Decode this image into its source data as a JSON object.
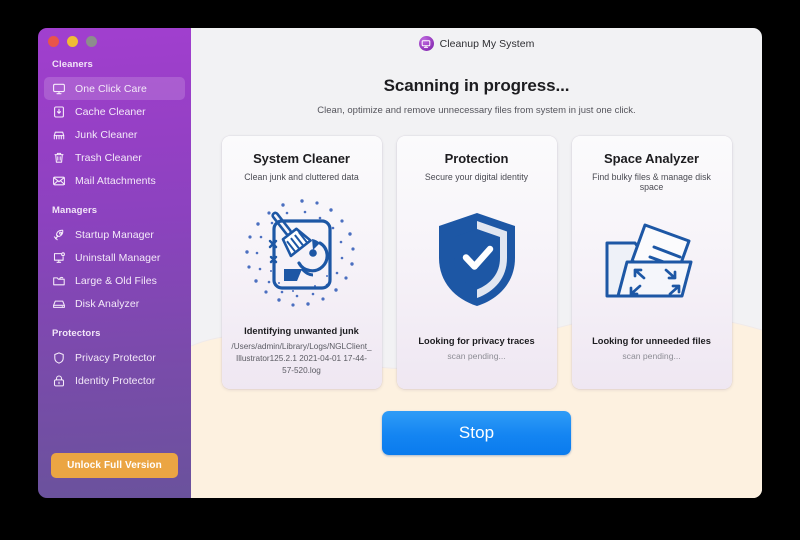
{
  "window": {
    "traffic_lights": [
      {
        "name": "close",
        "color": "#e8554a"
      },
      {
        "name": "minimize",
        "color": "#f0bb35"
      },
      {
        "name": "zoom",
        "color": "#8d8d8d"
      }
    ]
  },
  "header": {
    "app_title": "Cleanup My System",
    "app_icon": "monitor-icon",
    "headline": "Scanning in progress...",
    "subhead": "Clean, optimize and remove unnecessary files from system in just one click."
  },
  "sidebar": {
    "accent_button_color": "#eba543",
    "groups": [
      {
        "label": "Cleaners",
        "items": [
          {
            "label": "One Click Care",
            "icon": "monitor-icon",
            "active": true
          },
          {
            "label": "Cache Cleaner",
            "icon": "cache-box-icon",
            "active": false
          },
          {
            "label": "Junk Cleaner",
            "icon": "broom-icon",
            "active": false
          },
          {
            "label": "Trash Cleaner",
            "icon": "trash-icon",
            "active": false
          },
          {
            "label": "Mail Attachments",
            "icon": "envelope-icon",
            "active": false
          }
        ]
      },
      {
        "label": "Managers",
        "items": [
          {
            "label": "Startup Manager",
            "icon": "rocket-icon",
            "active": false
          },
          {
            "label": "Uninstall Manager",
            "icon": "monitor-badge-icon",
            "active": false
          },
          {
            "label": "Large & Old Files",
            "icon": "folder-open-icon",
            "active": false
          },
          {
            "label": "Disk Analyzer",
            "icon": "disk-drive-icon",
            "active": false
          }
        ]
      },
      {
        "label": "Protectors",
        "items": [
          {
            "label": "Privacy Protector",
            "icon": "shield-icon",
            "active": false
          },
          {
            "label": "Identity Protector",
            "icon": "padlock-icon",
            "active": false
          }
        ]
      }
    ],
    "unlock_label": "Unlock Full Version"
  },
  "cards": [
    {
      "title": "System Cleaner",
      "subtitle": "Clean junk and cluttered data",
      "icon": "broom-disk-scanning-icon",
      "status": "Identifying unwanted junk",
      "detail": "/Users/admin/Library/Logs/NGLClient_Illustrator125.2.1 2021-04-01 17-44-57-520.log",
      "pending": ""
    },
    {
      "title": "Protection",
      "subtitle": "Secure your digital identity",
      "icon": "shield-check-icon",
      "status": "Looking for privacy traces",
      "detail": "",
      "pending": "scan pending..."
    },
    {
      "title": "Space Analyzer",
      "subtitle": "Find bulky files & manage disk space",
      "icon": "folder-resize-icon",
      "status": "Looking for unneeded files",
      "detail": "",
      "pending": "scan pending..."
    }
  ],
  "actions": {
    "stop_label": "Stop",
    "stop_color": "#1485f2"
  }
}
